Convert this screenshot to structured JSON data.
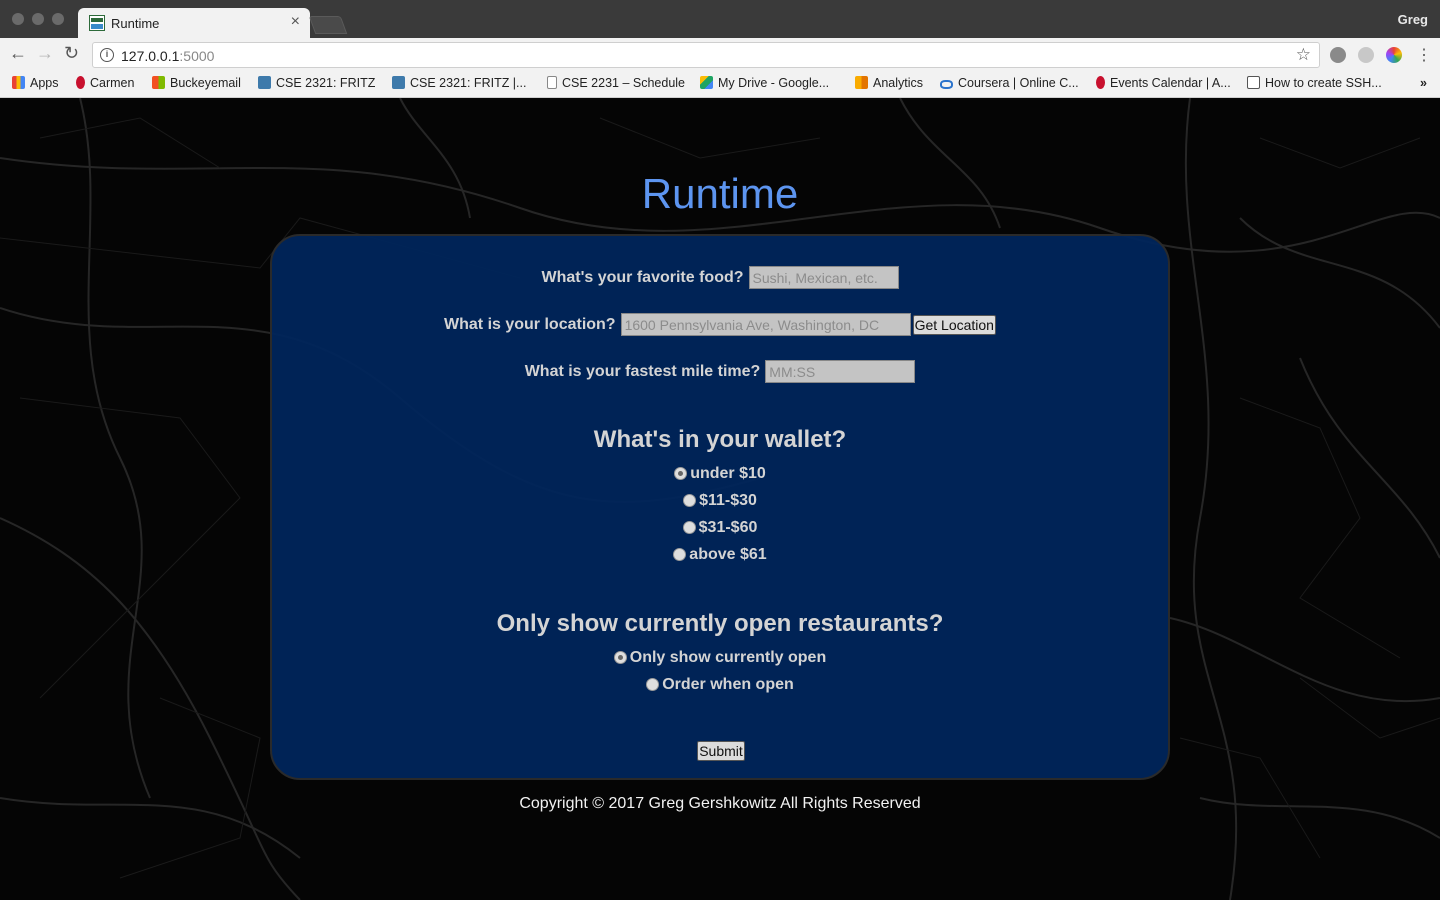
{
  "browser": {
    "tab_title": "Runtime",
    "tab_close": "×",
    "profile_name": "Greg",
    "url_host": "127.0.0.1",
    "url_port": ":5000",
    "bookmarks": [
      {
        "label": "Apps",
        "icon": "apps-grid-icon",
        "color": "#e94235"
      },
      {
        "label": "Carmen",
        "icon": "carmen-icon",
        "color": "#c8102e"
      },
      {
        "label": "Buckeyemail",
        "icon": "microsoft-icon",
        "color": "#f25022"
      },
      {
        "label": "CSE 2321: FRITZ",
        "icon": "piazza-icon",
        "color": "#3e7aab"
      },
      {
        "label": "CSE 2321: FRITZ |...",
        "icon": "piazza-icon",
        "color": "#3e7aab"
      },
      {
        "label": "CSE 2231 – Schedule",
        "icon": "document-icon",
        "color": "#888888"
      },
      {
        "label": "My Drive - Google...",
        "icon": "google-drive-icon",
        "color": "#1fa463"
      },
      {
        "label": "Analytics",
        "icon": "analytics-icon",
        "color": "#f9ab00"
      },
      {
        "label": "Coursera | Online C...",
        "icon": "coursera-icon",
        "color": "#2a73cc"
      },
      {
        "label": "Events Calendar | A...",
        "icon": "events-icon",
        "color": "#c8102e"
      },
      {
        "label": "How to create SSH...",
        "icon": "ssh-icon",
        "color": "#555555"
      }
    ],
    "bookmarks_overflow": "»"
  },
  "page": {
    "title": "Runtime",
    "food": {
      "label": "What's your favorite food?",
      "placeholder": "Sushi, Mexican, etc."
    },
    "location": {
      "label": "What is your location?",
      "placeholder": "1600 Pennsylvania Ave, Washington, DC",
      "button": "Get Location"
    },
    "mile": {
      "label": "What is your fastest mile time?",
      "placeholder": "MM:SS"
    },
    "wallet": {
      "heading": "What's in your wallet?",
      "options": [
        "under $10",
        "$11-$30",
        "$31-$60",
        "above $61"
      ],
      "selected": 0
    },
    "open": {
      "heading": "Only show currently open restaurants?",
      "options": [
        "Only show currently open",
        "Order when open"
      ],
      "selected": 0
    },
    "submit": "Submit",
    "footer": "Copyright © 2017 Greg Gershkowitz All Rights Reserved"
  },
  "colors": {
    "title": "#5d95f0",
    "panel": "#00265c"
  }
}
